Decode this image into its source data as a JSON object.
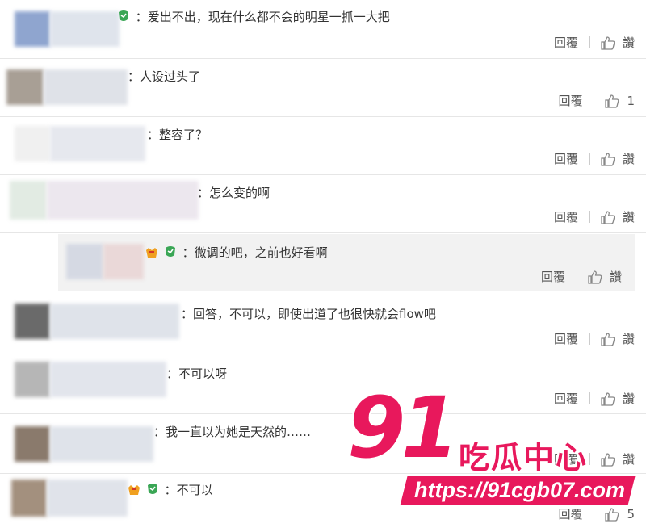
{
  "actions": {
    "reply": "回覆",
    "like": "讚"
  },
  "comments": [
    {
      "text": "：爱出不出，现在什么都不会的明星一抓一大把",
      "likes": "讚"
    },
    {
      "text": "：人设过头了",
      "likes": "1"
    },
    {
      "text": "：整容了？",
      "likes": "讚"
    },
    {
      "text": "：怎么变的啊",
      "likes": "讚"
    },
    {
      "text": "：微调的吧，之前也好看啊",
      "likes": "讚"
    },
    {
      "text": "：回答，不可以，即使出道了也很快就会flow吧",
      "likes": "讚"
    },
    {
      "text": "：不可以呀",
      "likes": "讚"
    },
    {
      "text": "：我一直以为她是天然的……",
      "likes": "讚"
    },
    {
      "text": "：不可以",
      "likes": "5"
    }
  ],
  "watermark": {
    "logo": "91",
    "name": "吃瓜中心",
    "url": "https://91cgb07.com",
    "color": "#e8185c"
  }
}
